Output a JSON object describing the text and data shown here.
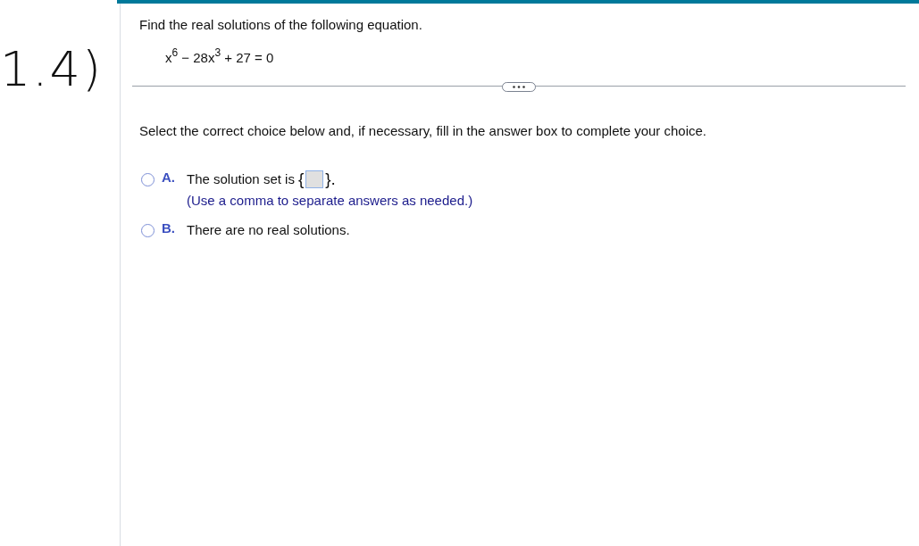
{
  "annotation": "1.4)",
  "question": {
    "prompt": "Find the real solutions of the following equation.",
    "equation": "x$^{6}$ − 28x$^{3}$ + 27 = 0"
  },
  "instruction": "Select the correct choice below and, if necessary, fill in the answer box to complete your choice.",
  "choices": [
    {
      "letter": "A.",
      "kind": "answer",
      "selected": false,
      "text_before": "The solution set is",
      "open_brace": "{",
      "close_brace": "}.",
      "hint": "(Use a comma to separate answers as needed.)"
    },
    {
      "letter": "B.",
      "kind": "plain",
      "selected": false,
      "text": "There are no real solutions."
    }
  ]
}
